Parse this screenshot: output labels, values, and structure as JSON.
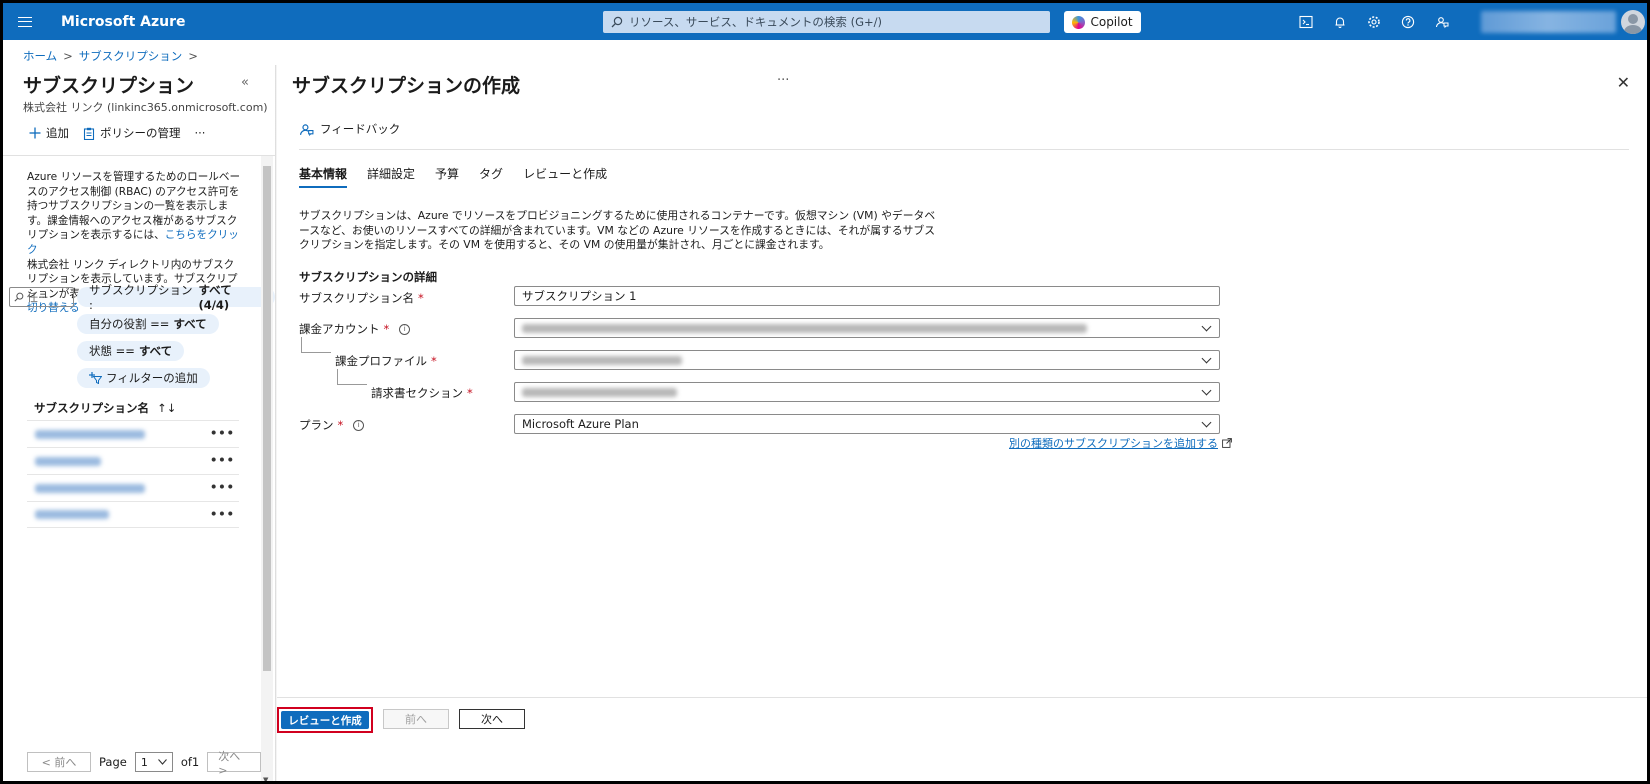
{
  "topbar": {
    "brand": "Microsoft Azure",
    "search_placeholder": "リソース、サービス、ドキュメントの検索 (G+/)",
    "copilot_label": "Copilot",
    "icons": [
      "cloud-shell-icon",
      "bell-icon",
      "gear-icon",
      "help-icon",
      "feedback-icon"
    ]
  },
  "breadcrumb": {
    "items": [
      "ホーム",
      "サブスクリプション"
    ],
    "separator": ">"
  },
  "left": {
    "title": "サブスクリプション",
    "collapse_glyph": "«",
    "subtitle": "株式会社 リンク (linkinc365.onmicrosoft.com)",
    "tools": {
      "add": "追加",
      "policy": "ポリシーの管理",
      "more": "···"
    },
    "desc_1": "Azure リソースを管理するためのロールベースのアクセス制御 (RBAC) のアクセス許可を持つサブスクリプションの一覧を表示します。課金情報へのアクセス権があるサブスクリプションを表示するには、",
    "desc_link_1": "こちらをクリック",
    "desc_2": "株式会社 リンク ディレクトリ内のサブスクリプションを表示しています。サブスクリプションが表示されませんか?",
    "desc_link_2": "ディレクトリを切り替える",
    "filter_placeholder": "任···",
    "pills": {
      "subscription_label": "サブスクリプション :",
      "subscription_value": "すべて (4/4)",
      "role_label": "自分の役割 ==",
      "role_value": "すべて",
      "state_label": "状態 ==",
      "state_value": "すべて",
      "add_filter": "フィルターの追加"
    },
    "list_header": "サブスクリプション名",
    "sort_glyph": "↑↓",
    "row_more": "•••",
    "pager": {
      "prev": "< 前へ",
      "page_label": "Page",
      "page_value": "1",
      "of_label": "of1",
      "next": "次へ >"
    }
  },
  "main": {
    "title": "サブスクリプションの作成",
    "more": "···",
    "close": "✕",
    "feedback": "フィードバック",
    "tabs": [
      "基本情報",
      "詳細設定",
      "予算",
      "タグ",
      "レビューと作成"
    ],
    "intro": "サブスクリプションは、Azure でリソースをプロビジョニングするために使用されるコンテナーです。仮想マシン (VM) やデータベースなど、お使いのリソースすべての詳細が含まれています。VM などの Azure リソースを作成するときには、それが属するサブスクリプションを指定します。その VM を使用すると、その VM の使用量が集計され、月ごとに課金されます。",
    "section_heading": "サブスクリプションの詳細",
    "fields": {
      "name_label": "サブスクリプション名",
      "name_value": "サブスクリプション 1",
      "billing_account_label": "課金アカウント",
      "billing_profile_label": "課金プロファイル",
      "invoice_section_label": "請求書セクション",
      "plan_label": "プラン",
      "plan_value": "Microsoft Azure Plan",
      "required_mark": "*",
      "info_glyph": "i"
    },
    "add_other_link": "別の種類のサブスクリプションを追加する",
    "buttons": {
      "review_create": "レビューと作成",
      "prev": "前へ",
      "next": "次へ"
    }
  },
  "colors": {
    "azure_blue": "#0f6cbd",
    "required_red": "#c50f1f",
    "highlight_red": "#d1001f"
  }
}
